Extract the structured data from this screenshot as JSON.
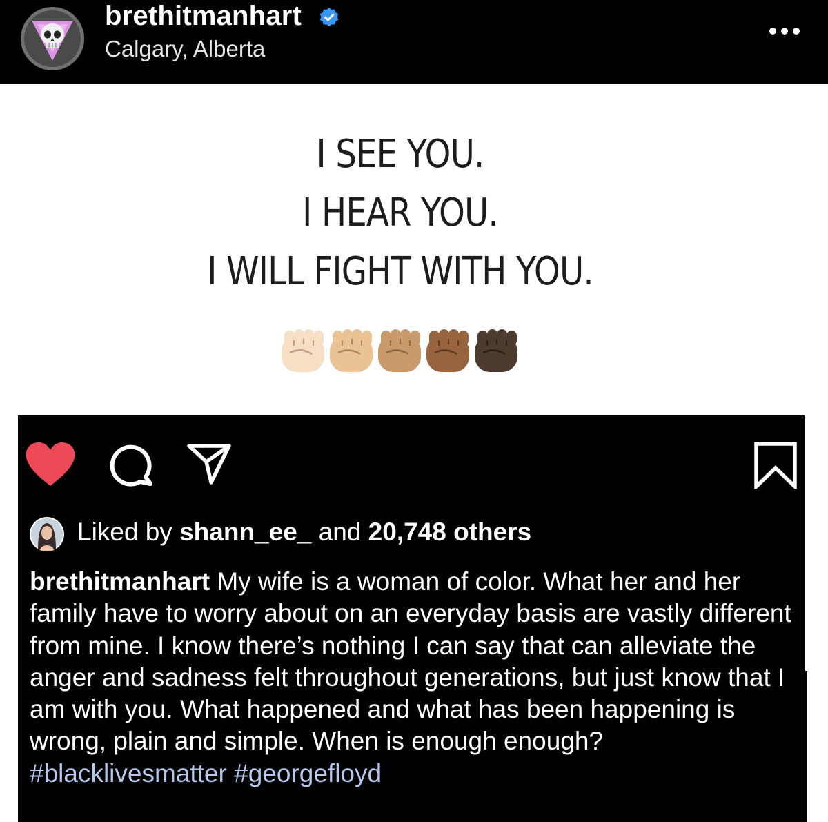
{
  "header": {
    "username": "brethitmanhart",
    "verified": true,
    "location": "Calgary, Alberta",
    "more_icon": "more-horizontal-icon"
  },
  "post_image": {
    "lines": [
      "I SEE YOU.",
      "I HEAR YOU.",
      "I WILL FIGHT WITH YOU."
    ],
    "emoji": "raised-fist-emoji x5 (skin tones light to dark)",
    "fist_colors": [
      "#f7dfc6",
      "#e9c394",
      "#c99a6a",
      "#97643f",
      "#4e3b30"
    ]
  },
  "actions": {
    "like_icon": "heart-icon",
    "liked": true,
    "like_color": "#ed4956",
    "comment_icon": "comment-icon",
    "share_icon": "share-icon",
    "save_icon": "bookmark-icon"
  },
  "likes": {
    "prefix": "Liked by",
    "user": "shann_ee_",
    "connector": "and",
    "count": "20,748 others"
  },
  "caption": {
    "username": "brethitmanhart",
    "text": "My wife is a woman of color. What her and her family have to worry about on an everyday basis are vastly different from mine. I know there’s nothing I can say that can alleviate the anger and sadness felt throughout generations, but just know that I am with you. What happened and what has been happening is wrong, plain and simple. When is enough enough?",
    "hashtags": [
      "#blacklivesmatter",
      "#georgefloyd"
    ],
    "hashtag_color": "#b6c9ec"
  }
}
